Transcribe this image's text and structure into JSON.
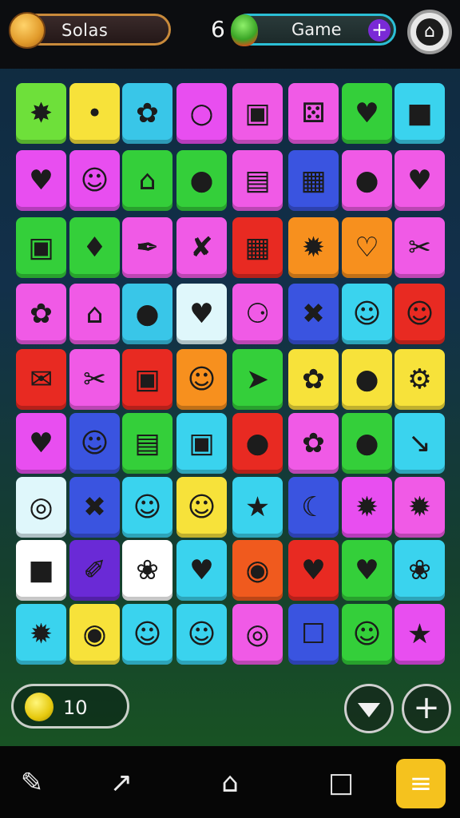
{
  "header": {
    "coin_label": "Solas",
    "score": "6",
    "game_label": "Game",
    "add_symbol": "+",
    "settings_symbol": "⌂"
  },
  "board": {
    "rows": [
      [
        [
          "#6ee03a",
          "✸"
        ],
        [
          "#f7e23a",
          "•"
        ],
        [
          "#39c6e8",
          "✿"
        ],
        [
          "#e84ef0",
          "○"
        ],
        [
          "#f05ae6",
          "▣"
        ],
        [
          "#f05ae6",
          "⚄"
        ],
        [
          "#34cf3a",
          "♥"
        ],
        [
          "#3ad3ee",
          "■"
        ]
      ],
      [
        [
          "#e84ef0",
          "♥"
        ],
        [
          "#e84ef0",
          "☺"
        ],
        [
          "#34cf3a",
          "⌂"
        ],
        [
          "#34cf3a",
          "●"
        ],
        [
          "#f05ae6",
          "▤"
        ],
        [
          "#3a54e0",
          "▦"
        ],
        [
          "#f05ae6",
          "●"
        ],
        [
          "#f05ae6",
          "♥"
        ]
      ],
      [
        [
          "#34cf3a",
          "▣"
        ],
        [
          "#34cf3a",
          "♦"
        ],
        [
          "#f05ae6",
          "✒"
        ],
        [
          "#f05ae6",
          "✘"
        ],
        [
          "#e82a22",
          "▦"
        ],
        [
          "#f7901e",
          "✹"
        ],
        [
          "#f7901e",
          "♡"
        ],
        [
          "#f05ae6",
          "✂"
        ]
      ],
      [
        [
          "#f05ae6",
          "✿"
        ],
        [
          "#f05ae6",
          "⌂"
        ],
        [
          "#39c6e8",
          "●"
        ],
        [
          "#dff7fb",
          "♥"
        ],
        [
          "#f05ae6",
          "⚆"
        ],
        [
          "#3a54e0",
          "✖"
        ],
        [
          "#3ad3ee",
          "☺"
        ],
        [
          "#e82a22",
          "☺"
        ]
      ],
      [
        [
          "#e82a22",
          "✉"
        ],
        [
          "#f05ae6",
          "✂"
        ],
        [
          "#e82a22",
          "▣"
        ],
        [
          "#f7901e",
          "☺"
        ],
        [
          "#34cf3a",
          "➤"
        ],
        [
          "#f7e23a",
          "✿"
        ],
        [
          "#f7e23a",
          "●"
        ],
        [
          "#f7e23a",
          "⚙"
        ]
      ],
      [
        [
          "#e84ef0",
          "♥"
        ],
        [
          "#3a54e0",
          "☺"
        ],
        [
          "#34cf3a",
          "▤"
        ],
        [
          "#3ad3ee",
          "▣"
        ],
        [
          "#e82a22",
          "●"
        ],
        [
          "#f05ae6",
          "✿"
        ],
        [
          "#34cf3a",
          "●"
        ],
        [
          "#3ad3ee",
          "↘"
        ]
      ],
      [
        [
          "#dff7fb",
          "◎"
        ],
        [
          "#3a54e0",
          "✖"
        ],
        [
          "#3ad3ee",
          "☺"
        ],
        [
          "#f7e23a",
          "☺"
        ],
        [
          "#3ad3ee",
          "★"
        ],
        [
          "#3a54e0",
          "☾"
        ],
        [
          "#e84ef0",
          "✹"
        ],
        [
          "#f05ae6",
          "✹"
        ]
      ],
      [
        [
          "#ffffff",
          "■"
        ],
        [
          "#6a2ad6",
          "✐"
        ],
        [
          "#ffffff",
          "❀"
        ],
        [
          "#3ad3ee",
          "♥"
        ],
        [
          "#f05a1e",
          "◉"
        ],
        [
          "#e82a22",
          "♥"
        ],
        [
          "#34cf3a",
          "♥"
        ],
        [
          "#3ad3ee",
          "❀"
        ]
      ],
      [
        [
          "#3ad3ee",
          "✹"
        ],
        [
          "#f7e23a",
          "◉"
        ],
        [
          "#3ad3ee",
          "☺"
        ],
        [
          "#3ad3ee",
          "☺"
        ],
        [
          "#f05ae6",
          "◎"
        ],
        [
          "#3a54e0",
          "☐"
        ],
        [
          "#34cf3a",
          "☺"
        ],
        [
          "#e84ef0",
          "★"
        ]
      ]
    ]
  },
  "controls": {
    "lives": "10",
    "add_symbol": "+"
  },
  "nav": {
    "pencil": "✎",
    "edit": "↗",
    "home": "⌂",
    "square": "□",
    "menu": "≡"
  }
}
